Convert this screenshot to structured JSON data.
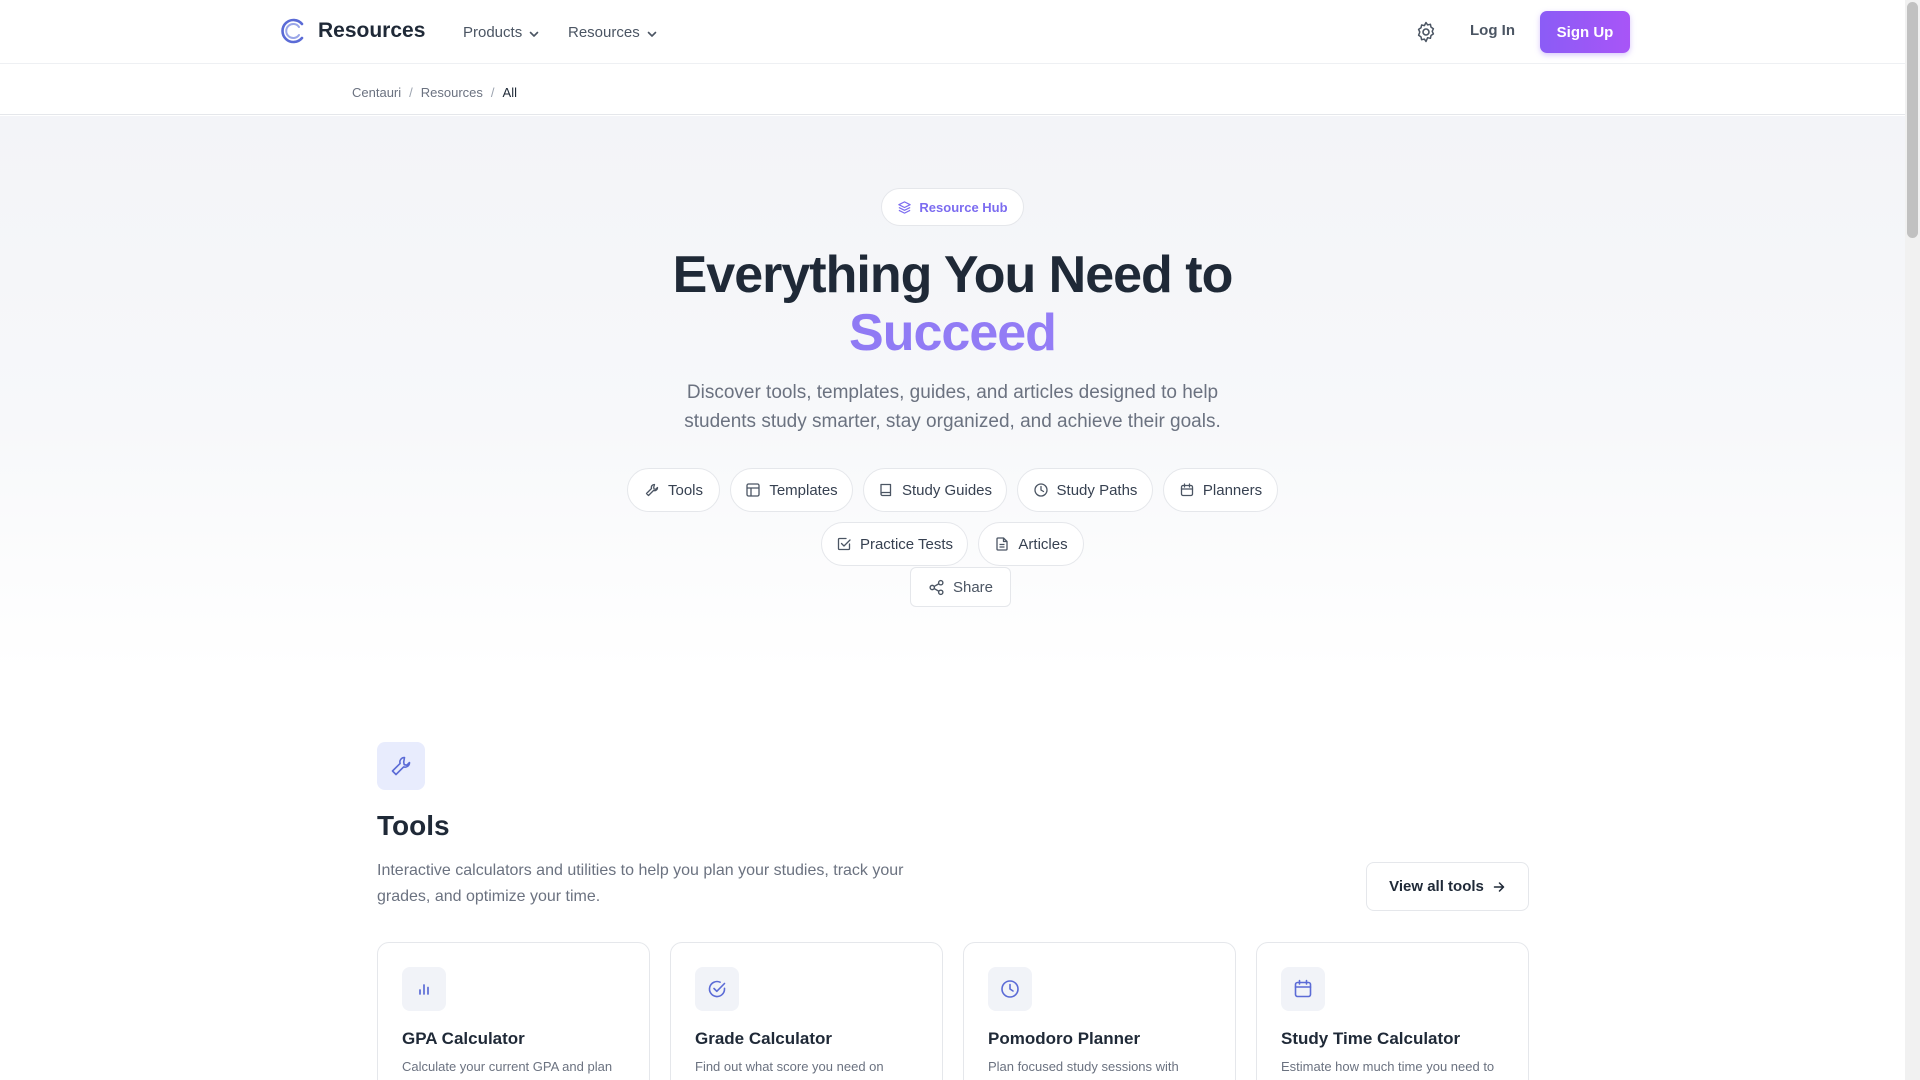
{
  "header": {
    "brand": "Resources",
    "nav": [
      {
        "label": "Products"
      },
      {
        "label": "Resources"
      }
    ],
    "login": "Log In",
    "signup": "Sign Up"
  },
  "breadcrumb": [
    "Centauri",
    "Resources",
    "All"
  ],
  "hero": {
    "badge": "Resource Hub",
    "title_line1": "Everything You Need to",
    "title_accent": "Succeed",
    "subtitle": "Discover tools, templates, guides, and articles designed to help students study smarter, stay organized, and achieve their goals.",
    "chips": [
      {
        "label": "Tools",
        "icon": "wrench-icon"
      },
      {
        "label": "Templates",
        "icon": "layout-icon"
      },
      {
        "label": "Study Guides",
        "icon": "book-icon"
      },
      {
        "label": "Study Paths",
        "icon": "clock-icon"
      },
      {
        "label": "Planners",
        "icon": "calendar-icon"
      },
      {
        "label": "Practice Tests",
        "icon": "check-square-icon"
      },
      {
        "label": "Articles",
        "icon": "file-text-icon"
      }
    ],
    "share": "Share"
  },
  "tools": {
    "title": "Tools",
    "description": "Interactive calculators and utilities to help you plan your studies, track your grades, and optimize your time.",
    "view_all": "View all tools",
    "cards": [
      {
        "title": "GPA Calculator",
        "desc": "Calculate your current GPA and plan",
        "icon": "bar-chart-icon"
      },
      {
        "title": "Grade Calculator",
        "desc": "Find out what score you need on",
        "icon": "check-circle-icon"
      },
      {
        "title": "Pomodoro Planner",
        "desc": "Plan focused study sessions with",
        "icon": "clock-icon"
      },
      {
        "title": "Study Time Calculator",
        "desc": "Estimate how much time you need to",
        "icon": "calendar-icon"
      }
    ]
  },
  "colors": {
    "accent": "#8b5cf6",
    "icon_blue": "#5b6bd6"
  }
}
